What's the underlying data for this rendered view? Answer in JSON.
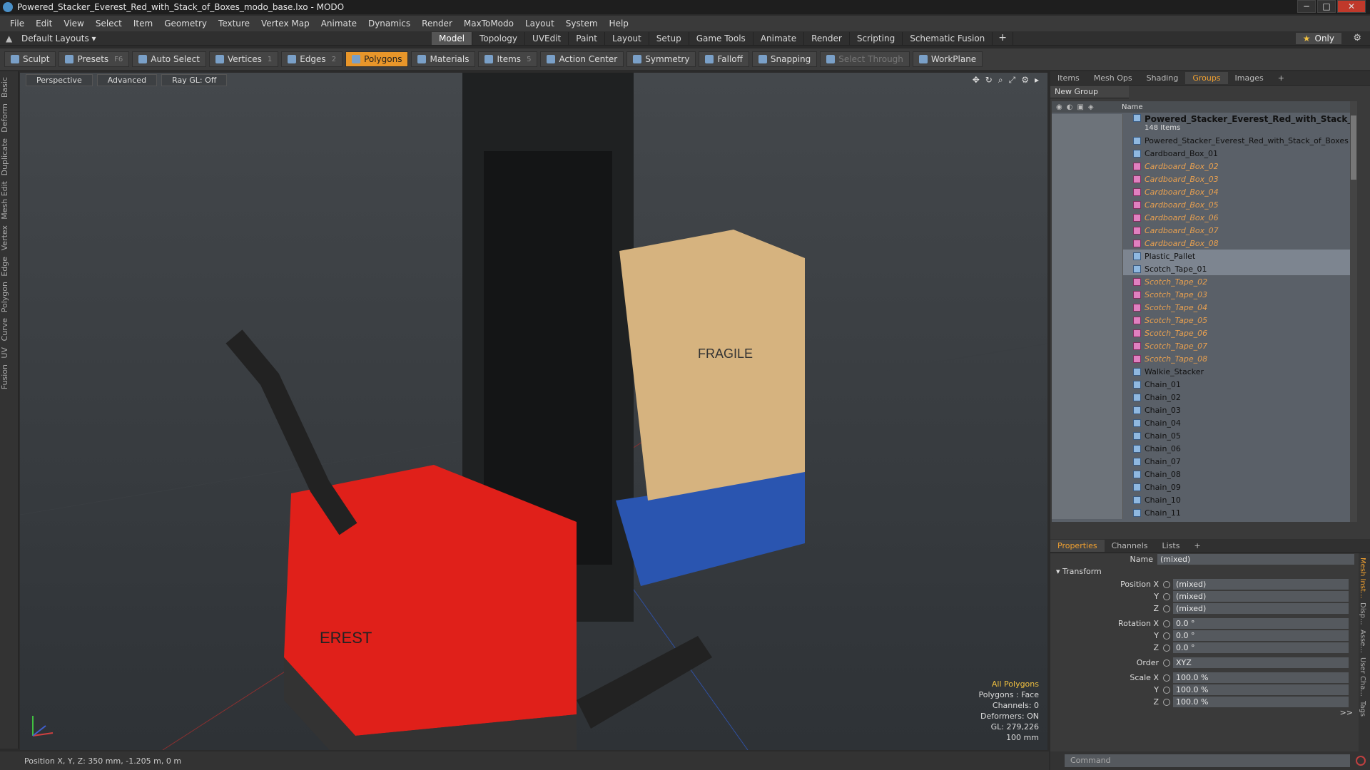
{
  "window": {
    "title": "Powered_Stacker_Everest_Red_with_Stack_of_Boxes_modo_base.lxo - MODO",
    "min": "─",
    "max": "□",
    "close": "✕"
  },
  "menu": [
    "File",
    "Edit",
    "View",
    "Select",
    "Item",
    "Geometry",
    "Texture",
    "Vertex Map",
    "Animate",
    "Dynamics",
    "Render",
    "MaxToModo",
    "Layout",
    "System",
    "Help"
  ],
  "layouts": {
    "default": "Default Layouts ▾",
    "tabs": [
      "Model",
      "Topology",
      "UVEdit",
      "Paint",
      "Layout",
      "Setup",
      "Game Tools",
      "Animate",
      "Render",
      "Scripting",
      "Schematic Fusion"
    ],
    "active": "Model",
    "plus": "+",
    "only": "Only"
  },
  "toolbar": [
    {
      "label": "Sculpt",
      "key": ""
    },
    {
      "label": "Presets",
      "key": "F6"
    },
    {
      "label": "Auto Select",
      "key": ""
    },
    {
      "label": "Vertices",
      "key": "1"
    },
    {
      "label": "Edges",
      "key": "2"
    },
    {
      "label": "Polygons",
      "key": "",
      "active": true
    },
    {
      "label": "Materials",
      "key": ""
    },
    {
      "label": "Items",
      "key": "5"
    },
    {
      "label": "Action Center",
      "key": ""
    },
    {
      "label": "Symmetry",
      "key": ""
    },
    {
      "label": "Falloff",
      "key": ""
    },
    {
      "label": "Snapping",
      "key": ""
    },
    {
      "label": "Select Through",
      "key": "",
      "dim": true
    },
    {
      "label": "WorkPlane",
      "key": ""
    }
  ],
  "left_tools": [
    "Basic",
    "Deform",
    "Duplicate",
    "Mesh Edit",
    "Vertex",
    "Edge",
    "Polygon",
    "Curve",
    "UV",
    "Fusion"
  ],
  "viewport": {
    "buttons": [
      "Perspective",
      "Advanced",
      "Ray GL: Off"
    ],
    "info": {
      "mode": "All Polygons",
      "polygons": "Polygons : Face",
      "channels": "Channels: 0",
      "deformers": "Deformers: ON",
      "gl": "GL: 279,226",
      "scale": "100 mm"
    },
    "box_label": "FRAGILE",
    "brand_label": "EREST"
  },
  "status": {
    "position": "Position X, Y, Z:  350 mm, -1.205 m, 0 m"
  },
  "panel_tabs": [
    "Items",
    "Mesh Ops",
    "Shading",
    "Groups",
    "Images",
    "+"
  ],
  "panel_active": "Groups",
  "groups": {
    "new_group": "New Group",
    "name_col": "Name",
    "root": {
      "name": "Powered_Stacker_Everest_Red_with_Stack_of_Bo...",
      "count": "148 Items"
    },
    "items": [
      {
        "n": "Powered_Stacker_Everest_Red_with_Stack_of_Boxes",
        "t": "loc"
      },
      {
        "n": "Cardboard_Box_01",
        "t": "mesh"
      },
      {
        "n": "Cardboard_Box_02",
        "t": "inst"
      },
      {
        "n": "Cardboard_Box_03",
        "t": "inst"
      },
      {
        "n": "Cardboard_Box_04",
        "t": "inst"
      },
      {
        "n": "Cardboard_Box_05",
        "t": "inst"
      },
      {
        "n": "Cardboard_Box_06",
        "t": "inst"
      },
      {
        "n": "Cardboard_Box_07",
        "t": "inst"
      },
      {
        "n": "Cardboard_Box_08",
        "t": "inst"
      },
      {
        "n": "Plastic_Pallet",
        "t": "mesh",
        "sel": true
      },
      {
        "n": "Scotch_Tape_01",
        "t": "mesh",
        "sel": true
      },
      {
        "n": "Scotch_Tape_02",
        "t": "inst"
      },
      {
        "n": "Scotch_Tape_03",
        "t": "inst"
      },
      {
        "n": "Scotch_Tape_04",
        "t": "inst"
      },
      {
        "n": "Scotch_Tape_05",
        "t": "inst"
      },
      {
        "n": "Scotch_Tape_06",
        "t": "inst"
      },
      {
        "n": "Scotch_Tape_07",
        "t": "inst"
      },
      {
        "n": "Scotch_Tape_08",
        "t": "inst"
      },
      {
        "n": "Walkie_Stacker",
        "t": "loc"
      },
      {
        "n": "Chain_01",
        "t": "mesh"
      },
      {
        "n": "Chain_02",
        "t": "mesh"
      },
      {
        "n": "Chain_03",
        "t": "mesh"
      },
      {
        "n": "Chain_04",
        "t": "mesh"
      },
      {
        "n": "Chain_05",
        "t": "mesh"
      },
      {
        "n": "Chain_06",
        "t": "mesh"
      },
      {
        "n": "Chain_07",
        "t": "mesh"
      },
      {
        "n": "Chain_08",
        "t": "mesh"
      },
      {
        "n": "Chain_09",
        "t": "mesh"
      },
      {
        "n": "Chain_10",
        "t": "mesh"
      },
      {
        "n": "Chain_11",
        "t": "mesh"
      }
    ]
  },
  "props_tabs": [
    "Properties",
    "Channels",
    "Lists",
    "+"
  ],
  "props": {
    "name_label": "Name",
    "name_value": "(mixed)",
    "section": "Transform",
    "rows": [
      {
        "l": "Position X",
        "v": "(mixed)"
      },
      {
        "l": "Y",
        "v": "(mixed)"
      },
      {
        "l": "Z",
        "v": "(mixed)"
      },
      {
        "l": "Rotation X",
        "v": "0.0 °"
      },
      {
        "l": "Y",
        "v": "0.0 °"
      },
      {
        "l": "Z",
        "v": "0.0 °"
      },
      {
        "l": "Order",
        "v": "XYZ"
      },
      {
        "l": "Scale X",
        "v": "100.0 %"
      },
      {
        "l": "Y",
        "v": "100.0 %"
      },
      {
        "l": "Z",
        "v": "100.0 %"
      }
    ],
    "more": ">>"
  },
  "side_tabs": [
    "Mesh Inst...",
    "Disp...",
    "Asse...",
    "User Cha...",
    "Tags"
  ],
  "command": {
    "placeholder": "Command"
  }
}
